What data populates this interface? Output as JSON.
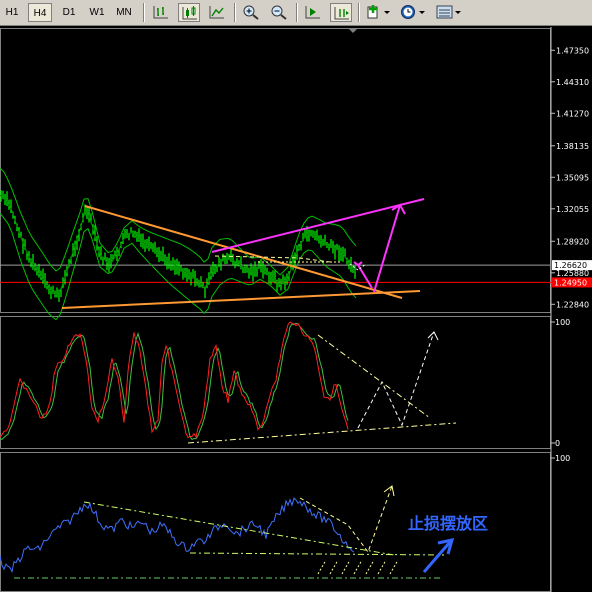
{
  "toolbar": {
    "timeframes": [
      {
        "label": "H1",
        "selected": false
      },
      {
        "label": "H4",
        "selected": true
      },
      {
        "label": "D1",
        "selected": false
      },
      {
        "label": "W1",
        "selected": false
      },
      {
        "label": "MN",
        "selected": false
      }
    ],
    "icons": [
      "bar-chart-icon",
      "candlestick-icon",
      "line-chart-icon",
      "zoom-in-icon",
      "zoom-out-icon",
      "chart-shift-icon",
      "autoscroll-icon",
      "indicators-icon",
      "periods-icon",
      "templates-icon"
    ]
  },
  "chart_data": [
    {
      "type": "line",
      "panel": "price",
      "y_ticks": [
        "1.47350",
        "1.44310",
        "1.41270",
        "1.38135",
        "1.35095",
        "1.32055",
        "1.28920",
        "1.25880",
        "1.22840"
      ],
      "price_labels": [
        {
          "text": "1.26620",
          "value": 1.2662,
          "color": "#ffffff",
          "bg": "#ffffff",
          "fg": "#000000"
        },
        {
          "text": "1.24950",
          "value": 1.2495,
          "color": "#ff0000",
          "bg": "#ff0000",
          "fg": "#ffffff"
        }
      ],
      "ylim": [
        1.22,
        1.495
      ],
      "series_color": "#00ff00",
      "envelope_color": "#00c000",
      "trend_colors": {
        "triangle": "#ff9933",
        "upper": "#ff33ff",
        "forecast": "#ff33ff",
        "dashed": "#ffff99"
      }
    },
    {
      "type": "line",
      "panel": "stochastic",
      "y_ticks": [
        "100",
        "0"
      ],
      "ylim": [
        0,
        100
      ],
      "main_color": "#ff2020",
      "signal_color": "#40c040",
      "trend_color": "#ffff99"
    },
    {
      "type": "line",
      "panel": "rsi",
      "y_ticks": [
        "100"
      ],
      "ylim": [
        0,
        100
      ],
      "series_color": "#4070ff",
      "trend_color": "#ccff66",
      "annotation": "止损摆放区",
      "annotation_color": "#3366ff"
    }
  ]
}
